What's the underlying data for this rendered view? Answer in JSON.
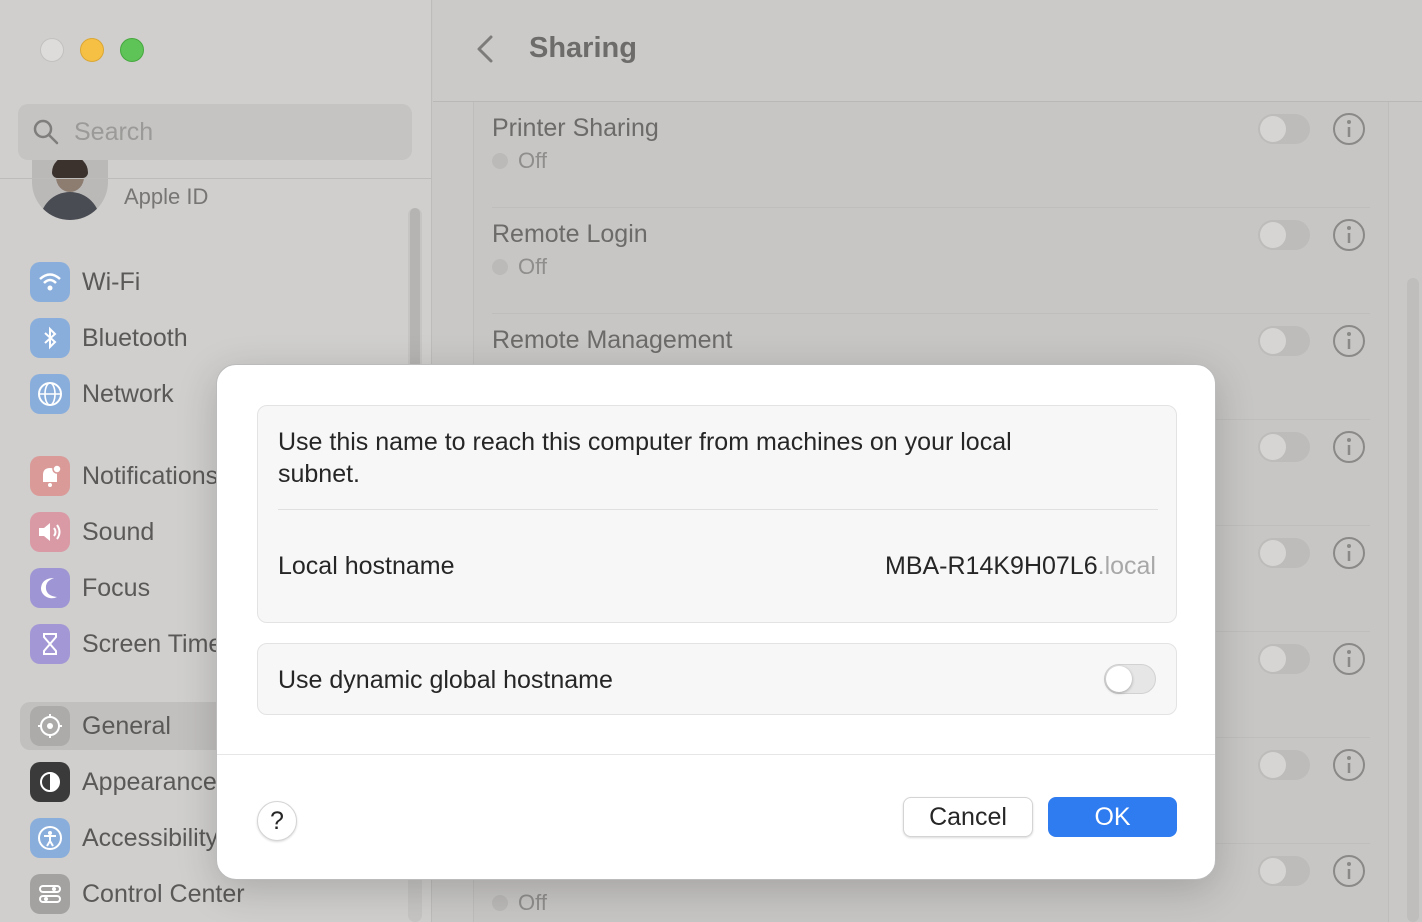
{
  "window": {
    "search_placeholder": "Search",
    "apple_id_label": "Apple ID"
  },
  "sidebar": {
    "items": [
      {
        "label": "Wi-Fi",
        "icon": "wifi-icon",
        "color": "#4a90e2"
      },
      {
        "label": "Bluetooth",
        "icon": "bluetooth-icon",
        "color": "#4a90e2"
      },
      {
        "label": "Network",
        "icon": "network-globe-icon",
        "color": "#4a90e2"
      },
      {
        "label": "Notifications",
        "icon": "notifications-bell-icon",
        "color": "#e25b5b"
      },
      {
        "label": "Sound",
        "icon": "sound-speaker-icon",
        "color": "#e25b7a"
      },
      {
        "label": "Focus",
        "icon": "focus-moon-icon",
        "color": "#6a5fd0"
      },
      {
        "label": "Screen Time",
        "icon": "screen-time-hourglass-icon",
        "color": "#7a62d4"
      },
      {
        "label": "General",
        "icon": "general-gear-icon",
        "color": "#9a9998"
      },
      {
        "label": "Appearance",
        "icon": "appearance-icon",
        "color": "#262626"
      },
      {
        "label": "Accessibility",
        "icon": "accessibility-icon",
        "color": "#4a90e2"
      },
      {
        "label": "Control Center",
        "icon": "control-center-icon",
        "color": "#8a8988"
      }
    ]
  },
  "main": {
    "title": "Sharing",
    "rows": [
      {
        "title": "Printer Sharing",
        "status": "Off"
      },
      {
        "title": "Remote Login",
        "status": "Off"
      },
      {
        "title": "Remote Management",
        "status": ""
      },
      {
        "title": "",
        "status": ""
      },
      {
        "title": "",
        "status": ""
      },
      {
        "title": "",
        "status": ""
      },
      {
        "title": "",
        "status": ""
      },
      {
        "title": "",
        "status": "Off"
      }
    ]
  },
  "dialog": {
    "description": "Use this name to reach this computer from machines on your local subnet.",
    "hostname_label": "Local hostname",
    "hostname_value": "MBA-R14K9H07L6",
    "hostname_suffix": ".local",
    "dynamic_label": "Use dynamic global hostname",
    "dynamic_enabled": false,
    "help_label": "?",
    "cancel_label": "Cancel",
    "ok_label": "OK",
    "accent_color": "#2f7cf0"
  }
}
